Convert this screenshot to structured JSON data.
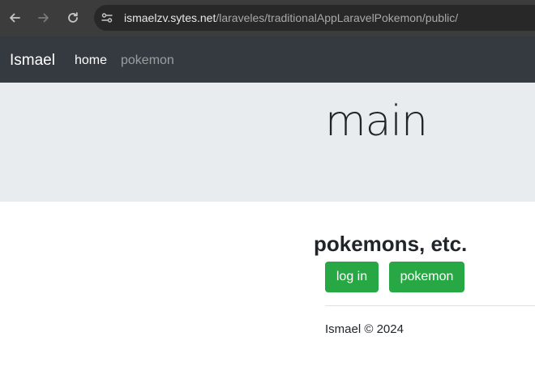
{
  "browser": {
    "url_host": "ismaelzv.sytes.net",
    "url_path": "/laraveles/traditionalAppLaravelPokemon/public/",
    "icons": [
      "back-arrow-icon",
      "forward-arrow-icon",
      "reload-icon",
      "site-settings-icon"
    ]
  },
  "navbar": {
    "brand": "Ismael",
    "links": [
      {
        "label": "home",
        "active": true
      },
      {
        "label": "pokemon",
        "active": false
      }
    ],
    "background": "#343a40"
  },
  "jumbotron": {
    "title": "main",
    "background": "#e9ecef"
  },
  "content": {
    "title": "pokemons, etc.",
    "buttons": [
      {
        "label": "log in"
      },
      {
        "label": "pokemon"
      }
    ],
    "button_color": "#28a745"
  },
  "footer": {
    "text": "Ismael © 2024"
  }
}
